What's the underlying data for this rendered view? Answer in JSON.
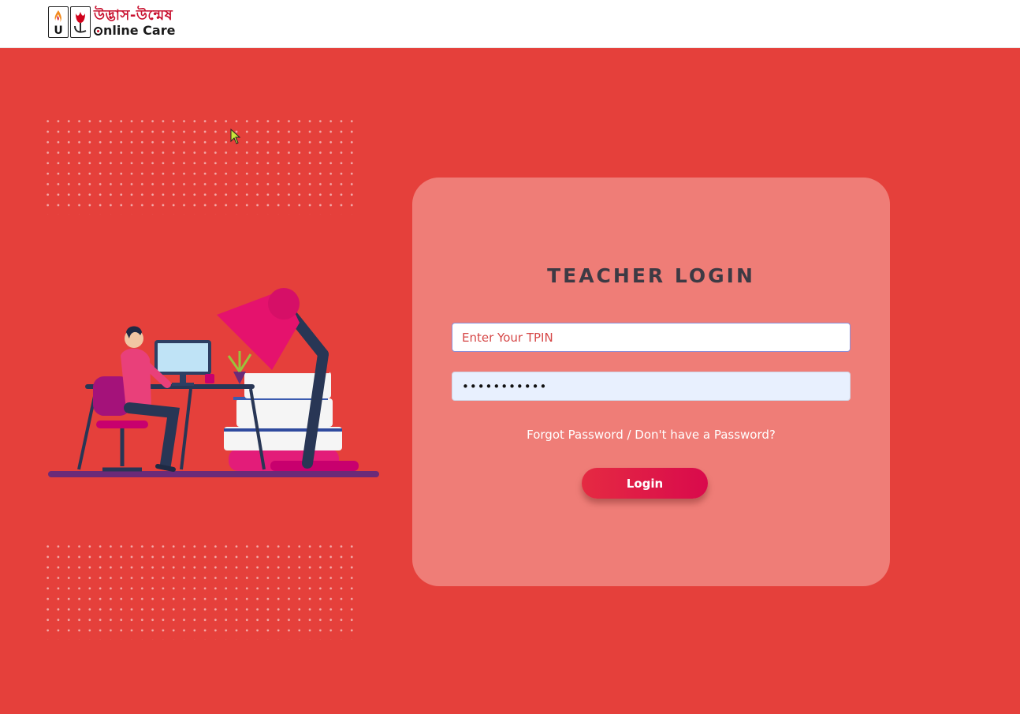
{
  "header": {
    "logo_title": "উদ্ভাস-উন্মেষ",
    "logo_subtitle": "nline Care",
    "logo_icon_names": [
      "flame-logo-icon",
      "tulip-logo-icon"
    ]
  },
  "login": {
    "title": "TEACHER LOGIN",
    "tpin_placeholder": "Enter Your TPIN",
    "tpin_value": "",
    "password_value": "•••••••••••",
    "forgot_link": "Forgot Password / Don't have a Password?",
    "login_button": "Login"
  },
  "colors": {
    "background": "#e5403b",
    "card": "#ef7d77",
    "title": "#3d3a44",
    "button": "#e01844",
    "brand_red": "#c8102e"
  }
}
